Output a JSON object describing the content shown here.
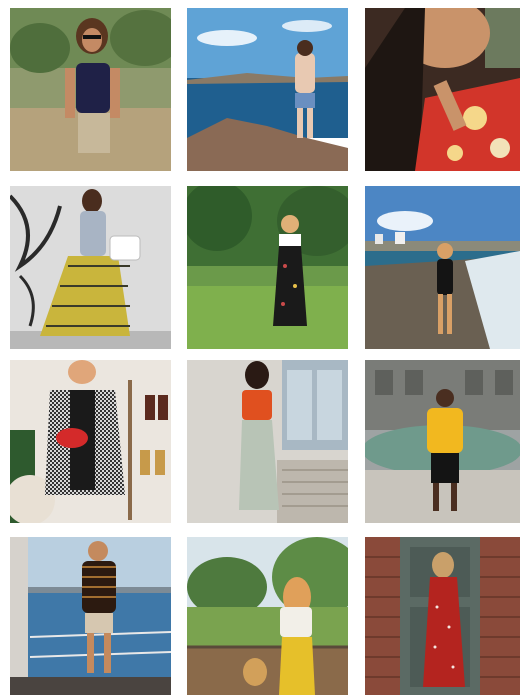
{
  "gallery": {
    "photos": [
      {
        "subject": "sunglasses-navy-cami-outdoor"
      },
      {
        "subject": "bikini-rocks-seaside"
      },
      {
        "subject": "red-floral-top-closeup"
      },
      {
        "subject": "yellow-gingham-skirt-graffiti"
      },
      {
        "subject": "black-floral-overalls-park"
      },
      {
        "subject": "black-swimsuit-beach"
      },
      {
        "subject": "houndstooth-blazer-peace-sign"
      },
      {
        "subject": "orange-top-lean-wall"
      },
      {
        "subject": "yellow-hoodie-fountain"
      },
      {
        "subject": "striped-shirt-boat-deck"
      },
      {
        "subject": "yellow-trousers-garden"
      },
      {
        "subject": "red-polka-dot-dress-door"
      }
    ]
  }
}
